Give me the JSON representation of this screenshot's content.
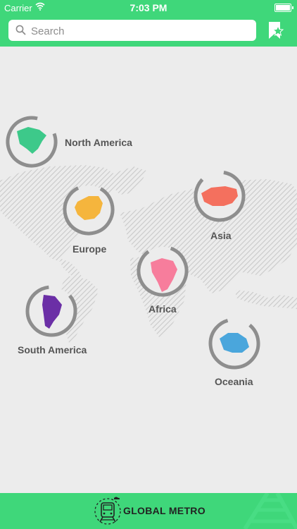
{
  "status": {
    "carrier": "Carrier",
    "time": "7:03 PM"
  },
  "search": {
    "placeholder": "Search",
    "value": ""
  },
  "icons": {
    "search": "search-icon",
    "bookmark": "star-bookmark-icon",
    "wifi": "wifi-icon",
    "battery": "battery-icon",
    "logo": "metro-train-icon"
  },
  "regions": [
    {
      "name": "North America",
      "color": "#3dc98a"
    },
    {
      "name": "Europe",
      "color": "#f5b53d"
    },
    {
      "name": "Asia",
      "color": "#f4705e"
    },
    {
      "name": "Africa",
      "color": "#f77d9c"
    },
    {
      "name": "South America",
      "color": "#6b2fa6"
    },
    {
      "name": "Oceania",
      "color": "#4aa6dc"
    }
  ],
  "footer": {
    "title": "GLOBAL METRO"
  },
  "colors": {
    "brand": "#3fd77a",
    "ring": "#8e8e8e",
    "background": "#ececec"
  }
}
